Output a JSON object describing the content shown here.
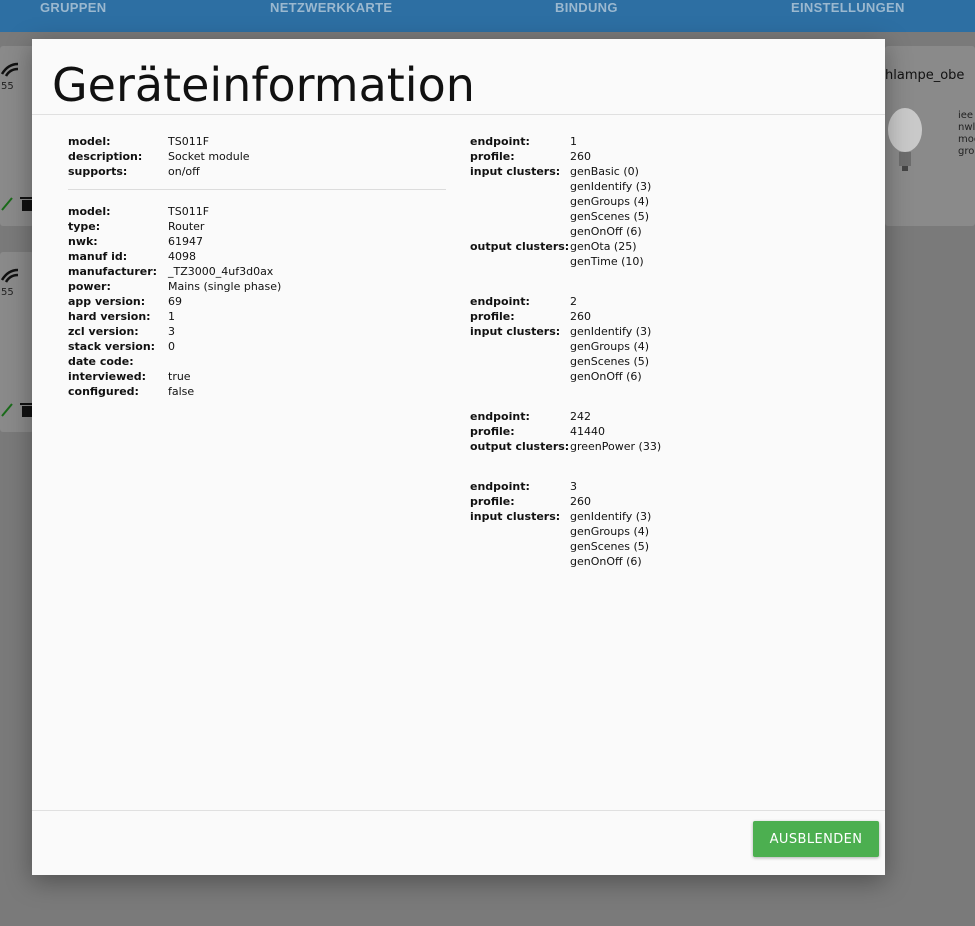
{
  "nav": {
    "tabs": [
      "GRUPPEN",
      "NETZWERKKARTE",
      "BINDUNG",
      "EINSTELLUNGEN"
    ]
  },
  "background": {
    "card_right_title": "hlampe_obe",
    "card_right_lines": [
      "iee",
      "nwl",
      "mod",
      "gro"
    ],
    "card_left_1_value": "55",
    "card_left_2_value": "55"
  },
  "dialog": {
    "title": "Geräteinformation",
    "definition": [
      {
        "key": "model:",
        "value": "TS011F"
      },
      {
        "key": "description:",
        "value": "Socket module"
      },
      {
        "key": "supports:",
        "value": "on/off"
      }
    ],
    "device": [
      {
        "key": "model:",
        "value": "TS011F"
      },
      {
        "key": "type:",
        "value": "Router"
      },
      {
        "key": "nwk:",
        "value": "61947"
      },
      {
        "key": "manuf id:",
        "value": "4098"
      },
      {
        "key": "manufacturer:",
        "value": "_TZ3000_4uf3d0ax"
      },
      {
        "key": "power:",
        "value": "Mains (single phase)"
      },
      {
        "key": "app version:",
        "value": "69"
      },
      {
        "key": "hard version:",
        "value": "1"
      },
      {
        "key": "zcl version:",
        "value": "3"
      },
      {
        "key": "stack version:",
        "value": "0"
      },
      {
        "key": "date code:",
        "value": ""
      },
      {
        "key": "interviewed:",
        "value": "true"
      },
      {
        "key": "configured:",
        "value": "false"
      }
    ],
    "endpoints": [
      [
        {
          "key": "endpoint:",
          "value": "1"
        },
        {
          "key": "profile:",
          "value": "260"
        },
        {
          "key": "input clusters:",
          "value": "genBasic (0)"
        },
        {
          "key": "",
          "value": "genIdentify (3)"
        },
        {
          "key": "",
          "value": "genGroups (4)"
        },
        {
          "key": "",
          "value": "genScenes (5)"
        },
        {
          "key": "",
          "value": "genOnOff (6)"
        },
        {
          "key": "output clusters:",
          "value": "genOta (25)"
        },
        {
          "key": "",
          "value": "genTime (10)"
        }
      ],
      [
        {
          "key": "endpoint:",
          "value": "2"
        },
        {
          "key": "profile:",
          "value": "260"
        },
        {
          "key": "input clusters:",
          "value": "genIdentify (3)"
        },
        {
          "key": "",
          "value": "genGroups (4)"
        },
        {
          "key": "",
          "value": "genScenes (5)"
        },
        {
          "key": "",
          "value": "genOnOff (6)"
        }
      ],
      [
        {
          "key": "endpoint:",
          "value": "242"
        },
        {
          "key": "profile:",
          "value": "41440"
        },
        {
          "key": "output clusters:",
          "value": "greenPower (33)"
        }
      ],
      [
        {
          "key": "endpoint:",
          "value": "3"
        },
        {
          "key": "profile:",
          "value": "260"
        },
        {
          "key": "input clusters:",
          "value": "genIdentify (3)"
        },
        {
          "key": "",
          "value": "genGroups (4)"
        },
        {
          "key": "",
          "value": "genScenes (5)"
        },
        {
          "key": "",
          "value": "genOnOff (6)"
        }
      ]
    ],
    "close_button": "AUSBLENDEN"
  },
  "colors": {
    "accent_button": "#4caf50",
    "topbar": "#2d6fa3",
    "overlay": "#7a7a7a"
  }
}
